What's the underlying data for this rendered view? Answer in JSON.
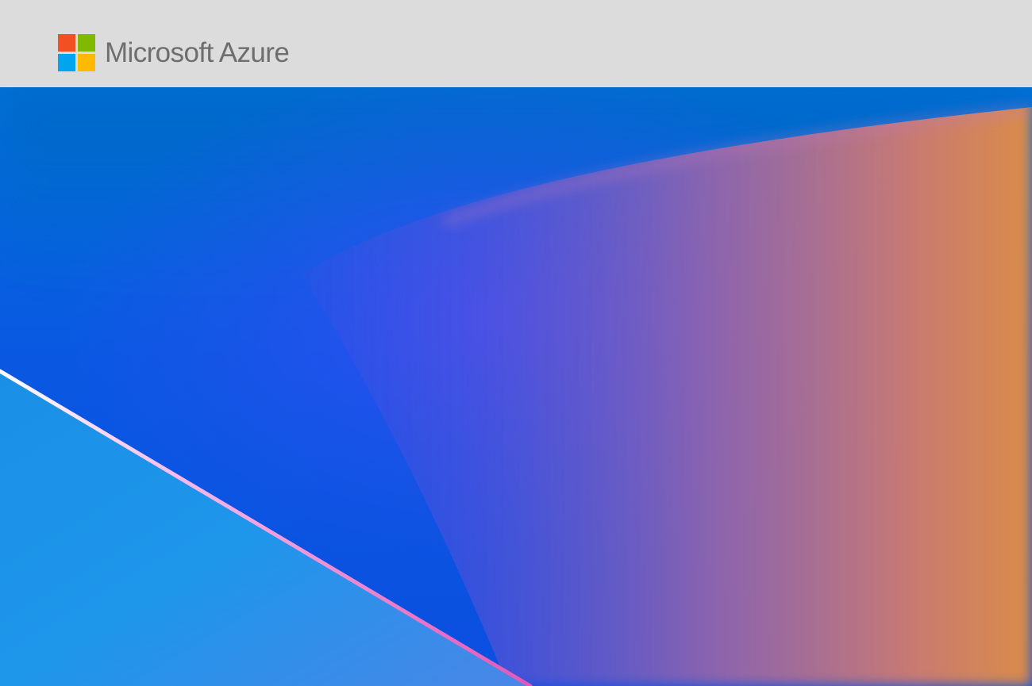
{
  "header": {
    "brand_name": "Microsoft Azure",
    "logo_colors": [
      "#f25022",
      "#7fba00",
      "#00a4ef",
      "#ffb900"
    ],
    "background": "#dcdcdc"
  },
  "hero": {
    "background_colors": [
      "#0a52e6",
      "#2a4ef0",
      "#6a4fd8",
      "#b06a9c",
      "#d98a4a"
    ],
    "accent_line_colors": [
      "#ffffff",
      "#ff9ad8",
      "#e05ab8"
    ]
  }
}
